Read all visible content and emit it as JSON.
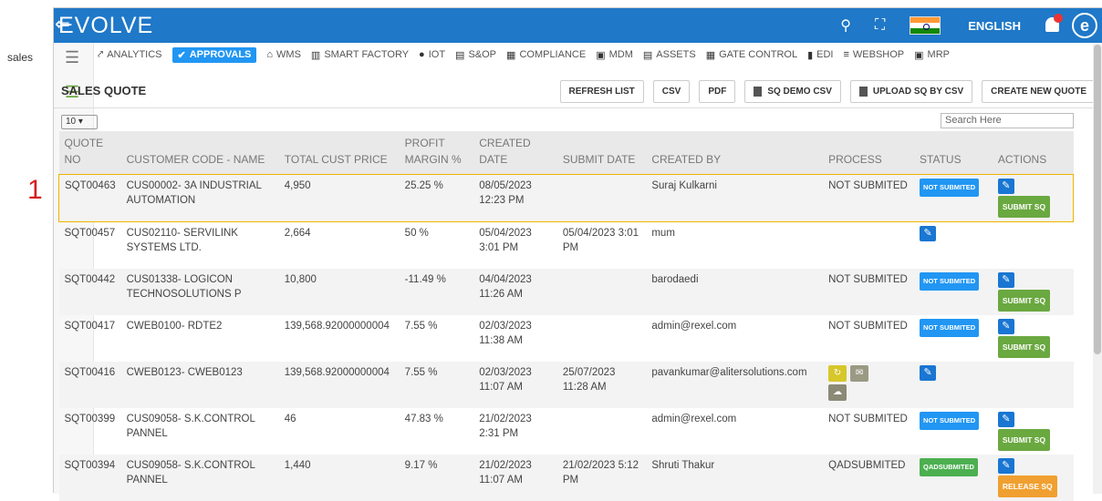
{
  "annotation": {
    "number": "1"
  },
  "header": {
    "logo": "EVOLVE",
    "language": "ENGLISH",
    "avatar_letter": "e"
  },
  "sidebar": {
    "label": "sales"
  },
  "modules": [
    {
      "icon": "⤤",
      "label": "ANALYTICS",
      "active": false
    },
    {
      "icon": "✔",
      "label": "APPROVALS",
      "active": true
    },
    {
      "icon": "⌂",
      "label": "WMS",
      "active": false
    },
    {
      "icon": "▥",
      "label": "SMART FACTORY",
      "active": false
    },
    {
      "icon": "●",
      "label": "IOT",
      "active": false
    },
    {
      "icon": "▤",
      "label": "S&OP",
      "active": false
    },
    {
      "icon": "▦",
      "label": "COMPLIANCE",
      "active": false
    },
    {
      "icon": "▣",
      "label": "MDM",
      "active": false
    },
    {
      "icon": "▤",
      "label": "ASSETS",
      "active": false
    },
    {
      "icon": "▦",
      "label": "GATE CONTROL",
      "active": false
    },
    {
      "icon": "▮",
      "label": "EDI",
      "active": false
    },
    {
      "icon": "≡",
      "label": "WEBSHOP",
      "active": false
    },
    {
      "icon": "▣",
      "label": "MRP",
      "active": false
    }
  ],
  "page": {
    "title": "SALES QUOTE",
    "buttons": [
      "REFRESH LIST",
      "CSV",
      "PDF",
      "SQ DEMO CSV",
      "UPLOAD SQ BY CSV",
      "CREATE NEW QUOTE"
    ],
    "page_size": "10",
    "search_placeholder": "Search Here"
  },
  "table": {
    "headers": [
      "QUOTE NO",
      "CUSTOMER CODE - NAME",
      "TOTAL CUST PRICE",
      "PROFIT MARGIN %",
      "CREATED DATE",
      "SUBMIT DATE",
      "CREATED BY",
      "PROCESS",
      "STATUS",
      "ACTIONS"
    ],
    "rows": [
      {
        "quote": "SQT00463",
        "customer": "CUS00002- 3A INDUSTRIAL AUTOMATION",
        "price": "4,950",
        "margin": "25.25 %",
        "created": "08/05/2023 12:23 PM",
        "submit": "",
        "by": "Suraj Kulkarni",
        "process": "NOT SUBMITED",
        "status": "NOT SUBMITED",
        "action": "SUBMIT SQ"
      },
      {
        "quote": "SQT00457",
        "customer": "CUS02110- SERVILINK SYSTEMS LTD.",
        "price": "2,664",
        "margin": "50 %",
        "created": "05/04/2023 3:01 PM",
        "submit": "05/04/2023 3:01 PM",
        "by": "mum",
        "process": "",
        "status": "",
        "action": ""
      },
      {
        "quote": "SQT00442",
        "customer": "CUS01338- LOGICON TECHNOSOLUTIONS P",
        "price": "10,800",
        "margin": "-11.49 %",
        "created": "04/04/2023 11:26 AM",
        "submit": "",
        "by": "barodaedi",
        "process": "NOT SUBMITED",
        "status": "NOT SUBMITED",
        "action": "SUBMIT SQ"
      },
      {
        "quote": "SQT00417",
        "customer": "CWEB0100- RDTE2",
        "price": "139,568.92000000004",
        "margin": "7.55 %",
        "created": "02/03/2023 11:38 AM",
        "submit": "",
        "by": "admin@rexel.com",
        "process": "NOT SUBMITED",
        "status": "NOT SUBMITED",
        "action": "SUBMIT SQ"
      },
      {
        "quote": "SQT00416",
        "customer": "CWEB0123- CWEB0123",
        "price": "139,568.92000000004",
        "margin": "7.55 %",
        "created": "02/03/2023 11:07 AM",
        "submit": "25/07/2023 11:28 AM",
        "by": "pavankumar@alitersolutions.com",
        "process": "",
        "status": "",
        "action": ""
      },
      {
        "quote": "SQT00399",
        "customer": "CUS09058- S.K.CONTROL PANNEL",
        "price": "46",
        "margin": "47.83 %",
        "created": "21/02/2023 2:31 PM",
        "submit": "",
        "by": "admin@rexel.com",
        "process": "NOT SUBMITED",
        "status": "NOT SUBMITED",
        "action": "SUBMIT SQ"
      },
      {
        "quote": "SQT00394",
        "customer": "CUS09058- S.K.CONTROL PANNEL",
        "price": "1,440",
        "margin": "9.17 %",
        "created": "21/02/2023 11:07 AM",
        "submit": "21/02/2023 5:12 PM",
        "by": "Shruti Thakur",
        "process": "QADSUBMITED",
        "status": "QADSUBMITED",
        "action": "RELEASE SQ"
      }
    ]
  }
}
